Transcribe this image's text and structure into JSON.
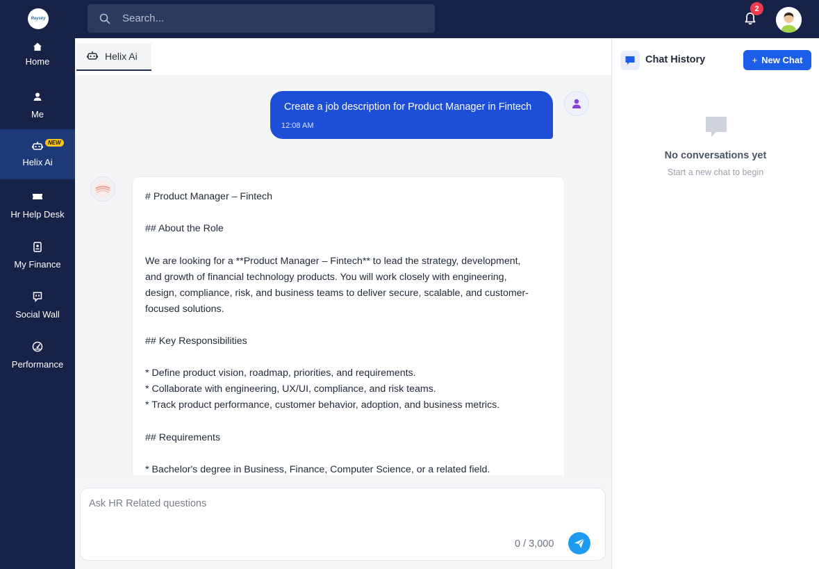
{
  "brand": {
    "logo_text": "Raysky"
  },
  "search": {
    "placeholder": "Search..."
  },
  "notifications": {
    "count": "2"
  },
  "sidebar": {
    "items": [
      {
        "label": "Home",
        "icon": "home-icon"
      },
      {
        "label": "Me",
        "icon": "user-icon"
      },
      {
        "label": "Helix Ai",
        "icon": "robot-icon",
        "badge": "NEW"
      },
      {
        "label": "Hr Help Desk",
        "icon": "ticket-icon"
      },
      {
        "label": "My Finance",
        "icon": "wallet-icon"
      },
      {
        "label": "Social Wall",
        "icon": "chat-square-icon"
      },
      {
        "label": "Performance",
        "icon": "gauge-icon"
      }
    ]
  },
  "tab": {
    "label": "Helix Ai"
  },
  "user_message": {
    "text": "Create a job description for Product Manager in Fintech",
    "time": "12:08 AM"
  },
  "bot_message": {
    "lines": [
      "# Product Manager – Fintech",
      "## About the Role",
      "We are looking for a **Product Manager – Fintech** to lead the strategy, development,",
      "and growth of financial technology products. You will work closely with engineering,",
      "design, compliance, risk, and business teams to deliver secure, scalable, and customer-",
      "focused solutions.",
      "## Key Responsibilities",
      "* Define product vision, roadmap, priorities, and requirements.",
      "* Collaborate with engineering, UX/UI, compliance, and risk teams.",
      "* Track product performance, customer behavior, adoption, and business metrics.",
      "## Requirements",
      "* Bachelor's degree in Business, Finance, Computer Science, or a related field."
    ]
  },
  "composer": {
    "placeholder": "Ask HR Related questions",
    "counter": "0 / 3,000"
  },
  "history": {
    "title": "Chat History",
    "new_chat_label": "New Chat",
    "plus": "+",
    "empty_title": "No conversations yet",
    "empty_subtitle": "Start a new chat to begin"
  },
  "colors": {
    "nav_bg": "#162247",
    "active_nav": "#1d3a78",
    "accent": "#1d4ed8",
    "send": "#1e9bf0",
    "badge": "#ef3b4e"
  }
}
